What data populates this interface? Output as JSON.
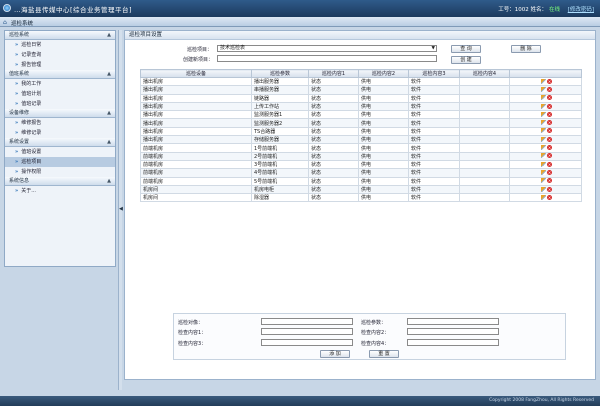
{
  "app": {
    "title": "…海盐县传媒中心[综合业务管理平台]",
    "user_text": "工号：1002 姓名：",
    "online": "在线",
    "logout": "[修改密码]",
    "breadcrumb": "巡检系统",
    "copyright": "Copyright 2008 FangZhou, All Rights Reserved"
  },
  "sidebar": {
    "sections": [
      {
        "title": "巡检系统",
        "items": [
          "巡检日常",
          "记录查询",
          "报告管理"
        ]
      },
      {
        "title": "值班系统",
        "items": [
          "我的工作",
          "值班计划",
          "值班记录"
        ]
      },
      {
        "title": "设备维修",
        "items": [
          "维修报告",
          "维修记录"
        ]
      },
      {
        "title": "系统设置",
        "items": [
          "值班设置",
          "巡检项目",
          "操作权限"
        ]
      },
      {
        "title": "系统信息",
        "items": [
          "关于..."
        ]
      }
    ],
    "active_item": "巡检项目"
  },
  "main": {
    "title": "巡检项目设置",
    "project_label": "巡检项目：",
    "project_value": "技术巡检表",
    "new_project_label": "创建新项目：",
    "btn_query": "查 询",
    "btn_delete": "删 除",
    "btn_create": "创 建",
    "columns": [
      "巡检设备",
      "巡检参数",
      "巡检内容1",
      "巡检内容2",
      "巡检内容3",
      "巡检内容4",
      ""
    ],
    "rows": [
      [
        "播出机房",
        "播出服务器",
        "状态",
        "供电",
        "软件",
        ""
      ],
      [
        "播出机房",
        "串播服务器",
        "状态",
        "供电",
        "软件",
        ""
      ],
      [
        "播出机房",
        "链路器",
        "状态",
        "供电",
        "软件",
        ""
      ],
      [
        "播出机房",
        "上传工作站",
        "状态",
        "供电",
        "软件",
        ""
      ],
      [
        "播出机房",
        "监测服务器1",
        "状态",
        "供电",
        "软件",
        ""
      ],
      [
        "播出机房",
        "监测服务器2",
        "状态",
        "供电",
        "软件",
        ""
      ],
      [
        "播出机房",
        "TS合路器",
        "状态",
        "供电",
        "软件",
        ""
      ],
      [
        "播出机房",
        "存储服务器",
        "状态",
        "供电",
        "软件",
        ""
      ],
      [
        "前端机房",
        "1号前端机",
        "状态",
        "供电",
        "软件",
        ""
      ],
      [
        "前端机房",
        "2号前端机",
        "状态",
        "供电",
        "软件",
        ""
      ],
      [
        "前端机房",
        "3号前端机",
        "状态",
        "供电",
        "软件",
        ""
      ],
      [
        "前端机房",
        "4号前端机",
        "状态",
        "供电",
        "软件",
        ""
      ],
      [
        "前端机房",
        "5号前端机",
        "状态",
        "供电",
        "软件",
        ""
      ],
      [
        "机房间",
        "机房电柜",
        "状态",
        "供电",
        "软件",
        ""
      ],
      [
        "机房间",
        "除湿器",
        "状态",
        "供电",
        "软件",
        ""
      ]
    ],
    "form": {
      "device_label": "巡检对像：",
      "param_label": "巡检参数：",
      "content1_label": "检查内容1：",
      "content2_label": "检查内容2：",
      "content3_label": "检查内容3：",
      "content4_label": "检查内容4：",
      "add_label": "添 加",
      "reset_label": "重 置"
    }
  }
}
